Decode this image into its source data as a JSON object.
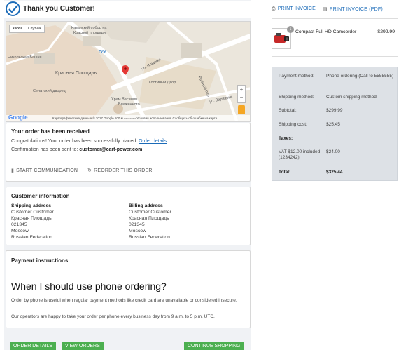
{
  "header": {
    "title": "Thank you Customer!"
  },
  "map": {
    "type_map": "Карта",
    "type_sat": "Спутник",
    "labels": {
      "kazan": "Казанский собор на",
      "kazan2": "Красной площади",
      "gum": "ГУМ",
      "ilyinka": "ул. Ильинка",
      "tower": "Никольская Башня",
      "red_sq": "Красная Площадь",
      "senate": "Сенатский дворец",
      "gostiny": "Гостиный Двор",
      "vasily": "Храм Василия",
      "vasily2": "Блаженного",
      "rybny": "Рыбный пер.",
      "varvarka": "ул. Варварка"
    },
    "google": "Google",
    "footer": "Картографические данные © 2017 Google    100 м ▭▭▭▭    Условия использования    Сообщить об ошибке на карте"
  },
  "order": {
    "title": "Your order has been received",
    "congrats": "Congratulations! Your order has been successfully placed.",
    "details_link": "Order details",
    "confirm_prefix": "Confirmation has been sent to:",
    "email": "customer@cart-power.com",
    "start_comm": "START COMMUNICATION",
    "reorder": "REORDER THIS ORDER"
  },
  "customer": {
    "title": "Customer information",
    "shipping": {
      "title": "Shipping address",
      "lines": [
        "Customer Customer",
        "Красная Площадь",
        "021345",
        "Moscow",
        "Russian Federation"
      ]
    },
    "billing": {
      "title": "Billing address",
      "lines": [
        "Customer Customer",
        "Красная Площадь",
        "021345",
        "Moscow",
        "Russian Federation"
      ]
    }
  },
  "payment": {
    "title": "Payment instructions",
    "question": "When I should use phone ordering?",
    "p1": "Order by phone is useful when regular payment methods like credit card are unavailable or considered insecure.",
    "p2": "Our operators are happy to take your order per phone every business day from 9 a.m. to 5 p.m. UTC."
  },
  "buttons": {
    "details": "ORDER DETAILS",
    "view": "VIEW ORDERS",
    "continue": "CONTINUE SHOPPING"
  },
  "print": {
    "invoice": "PRINT INVOICE",
    "pdf": "PRINT INVOICE (PDF)"
  },
  "product": {
    "qty": "1",
    "name": "Compact Full HD Camcorder",
    "price": "$299.99"
  },
  "summary": {
    "payment_label": "Payment method:",
    "payment_value": "Phone ordering (Call to 5555555)",
    "shipping_label": "Shipping method:",
    "shipping_value": "Custom shipping method",
    "subtotal_label": "Subtotal:",
    "subtotal_value": "$299.99",
    "shipcost_label": "Shipping cost:",
    "shipcost_value": "$25.45",
    "taxes_label": "Taxes:",
    "vat_label": "VAT $12.00 included (1234242)",
    "vat_value": "$24.00",
    "total_label": "Total:",
    "total_value": "$325.44"
  },
  "colors": {
    "accent": "#1b6bb8",
    "button": "#4caf50",
    "summary_bg": "#dde1e6"
  }
}
